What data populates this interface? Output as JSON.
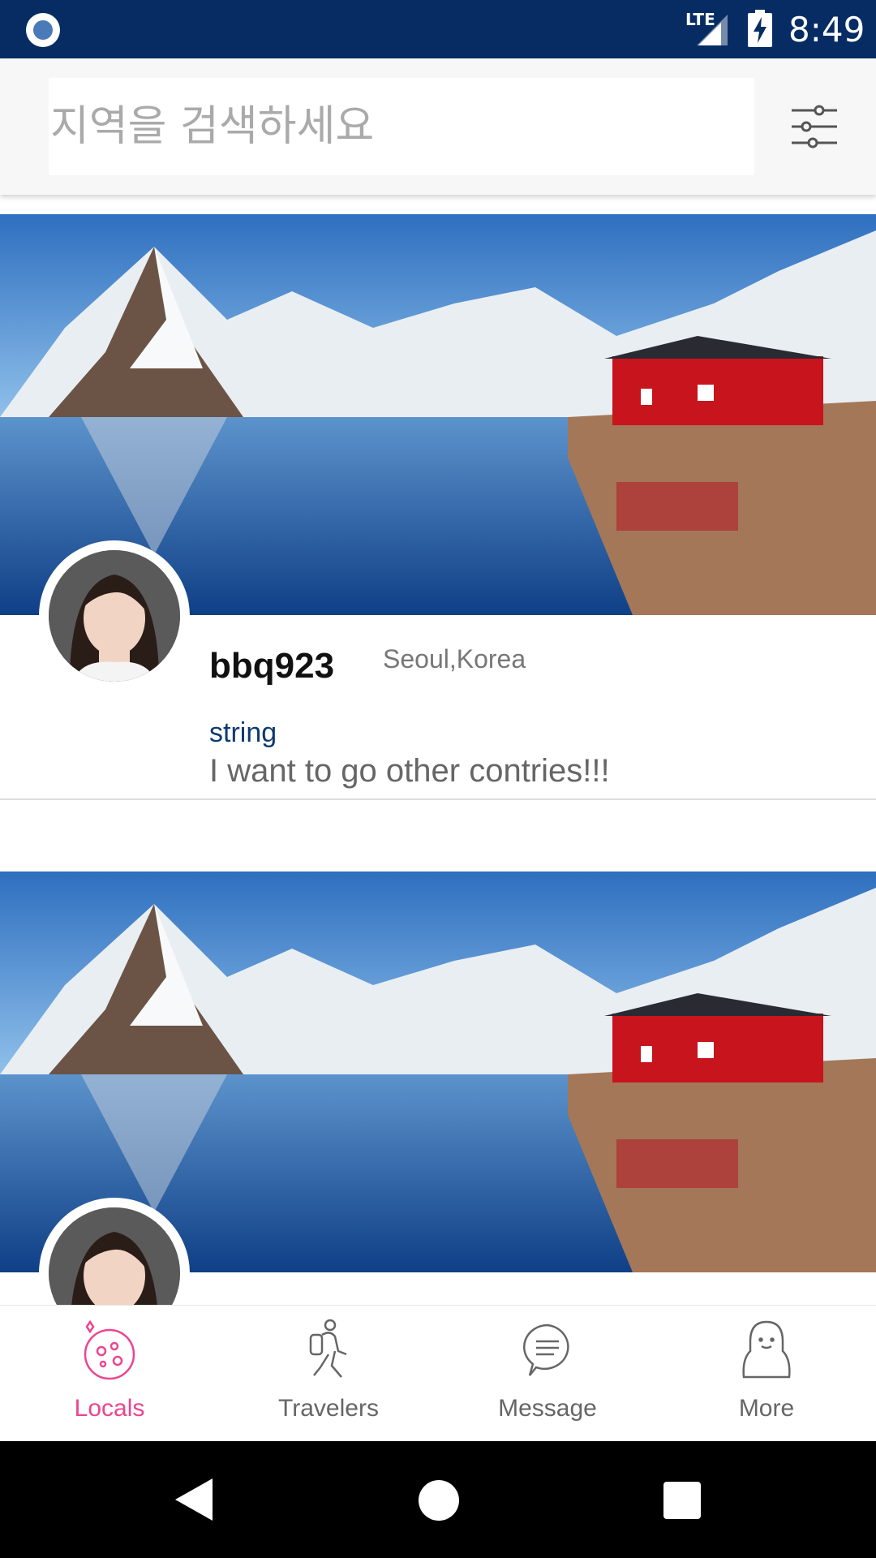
{
  "status_bar": {
    "network": "LTE",
    "time": "8:49",
    "left_icon": "notification-circle-icon",
    "signal_icon": "cell-signal-icon",
    "battery_icon": "battery-charging-icon"
  },
  "search": {
    "placeholder": "지역을 검색하세요",
    "filter_icon": "sliders-filter-icon"
  },
  "cards": [
    {
      "cover_image": "mountain-lake-red-house-photo",
      "avatar": "user-avatar-photo",
      "username": "bbq923",
      "location": "Seoul,Korea",
      "subtitle": "string",
      "message": "I want to go other contries!!!"
    },
    {
      "cover_image": "mountain-lake-red-house-photo",
      "avatar": "user-avatar-photo"
    }
  ],
  "bottom_nav": {
    "active": "Locals",
    "accent_color": "#ec4590",
    "items": [
      {
        "label": "Locals",
        "icon": "planet-icon"
      },
      {
        "label": "Travelers",
        "icon": "backpacker-icon"
      },
      {
        "label": "Message",
        "icon": "chat-bubble-icon"
      },
      {
        "label": "More",
        "icon": "ghost-person-icon"
      }
    ]
  },
  "system_nav": {
    "back_icon": "back-triangle-icon",
    "home_icon": "home-circle-icon",
    "recent_icon": "recent-square-icon"
  },
  "colors": {
    "status_bar": "#062c63",
    "subtitle": "#0d3a73"
  }
}
